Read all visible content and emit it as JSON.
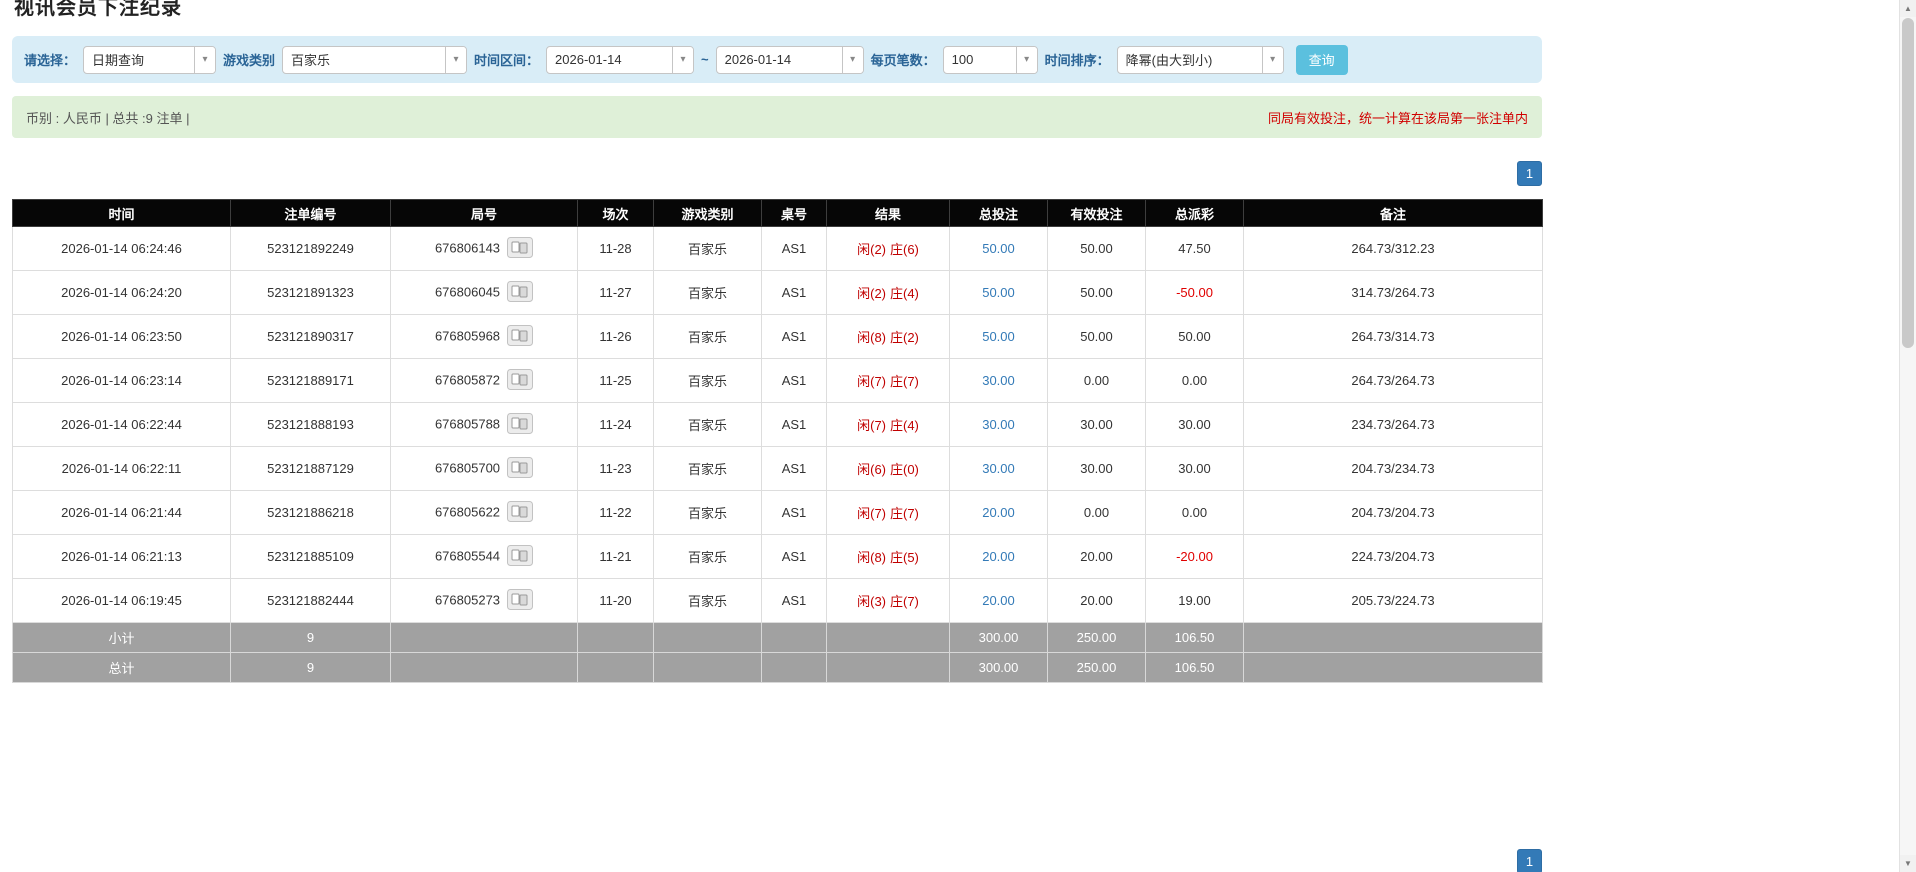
{
  "colors": {
    "accent_blue": "#337ab7",
    "filter_bar_bg": "#d9edf7",
    "summary_bar_bg": "#dff0d8",
    "table_header_bg": "#060606",
    "table_footer_bg": "#a1a1a1",
    "search_button_bg": "#5bc0de",
    "negative_red": "#e00000",
    "notice_red": "#d10000",
    "result_red": "#c00000"
  },
  "icons": {
    "chevron_down": "▾",
    "scroll_up": "▲",
    "scroll_down": "▼"
  },
  "page": {
    "title": "视讯会员下注纪录"
  },
  "filters": {
    "select_label": "请选择：",
    "select_value": "日期查询",
    "game_type_label": "游戏类别",
    "game_type_value": "百家乐",
    "time_range_label": "时间区间：",
    "date_from": "2026-01-14",
    "range_separator": "~",
    "date_to": "2026-01-14",
    "per_page_label": "每页笔数：",
    "per_page_value": "100",
    "sort_label": "时间排序：",
    "sort_value": "降幂(由大到小)",
    "search_button": "查询"
  },
  "summary": {
    "left": "币别 : 人民币 | 总共 :9 注单 |",
    "right": "同局有效投注，统一计算在该局第一张注单内"
  },
  "pagination": {
    "page": "1"
  },
  "table": {
    "headers": [
      "时间",
      "注单编号",
      "局号",
      "场次",
      "游戏类别",
      "桌号",
      "结果",
      "总投注",
      "有效投注",
      "总派彩",
      "备注"
    ],
    "rows": [
      {
        "time": "2026-01-14 06:24:46",
        "bet_id": "523121892249",
        "round": "676806143",
        "session": "11-28",
        "game": "百家乐",
        "table_no": "AS1",
        "result_player": "闲(2)",
        "result_banker": "庄(6)",
        "total_bet": "50.00",
        "valid_bet": "50.00",
        "payout": "47.50",
        "remark": "264.73/312.23"
      },
      {
        "time": "2026-01-14 06:24:20",
        "bet_id": "523121891323",
        "round": "676806045",
        "session": "11-27",
        "game": "百家乐",
        "table_no": "AS1",
        "result_player": "闲(2)",
        "result_banker": "庄(4)",
        "total_bet": "50.00",
        "valid_bet": "50.00",
        "payout": "-50.00",
        "remark": "314.73/264.73"
      },
      {
        "time": "2026-01-14 06:23:50",
        "bet_id": "523121890317",
        "round": "676805968",
        "session": "11-26",
        "game": "百家乐",
        "table_no": "AS1",
        "result_player": "闲(8)",
        "result_banker": "庄(2)",
        "total_bet": "50.00",
        "valid_bet": "50.00",
        "payout": "50.00",
        "remark": "264.73/314.73"
      },
      {
        "time": "2026-01-14 06:23:14",
        "bet_id": "523121889171",
        "round": "676805872",
        "session": "11-25",
        "game": "百家乐",
        "table_no": "AS1",
        "result_player": "闲(7)",
        "result_banker": "庄(7)",
        "total_bet": "30.00",
        "valid_bet": "0.00",
        "payout": "0.00",
        "remark": "264.73/264.73"
      },
      {
        "time": "2026-01-14 06:22:44",
        "bet_id": "523121888193",
        "round": "676805788",
        "session": "11-24",
        "game": "百家乐",
        "table_no": "AS1",
        "result_player": "闲(7)",
        "result_banker": "庄(4)",
        "total_bet": "30.00",
        "valid_bet": "30.00",
        "payout": "30.00",
        "remark": "234.73/264.73"
      },
      {
        "time": "2026-01-14 06:22:11",
        "bet_id": "523121887129",
        "round": "676805700",
        "session": "11-23",
        "game": "百家乐",
        "table_no": "AS1",
        "result_player": "闲(6)",
        "result_banker": "庄(0)",
        "total_bet": "30.00",
        "valid_bet": "30.00",
        "payout": "30.00",
        "remark": "204.73/234.73"
      },
      {
        "time": "2026-01-14 06:21:44",
        "bet_id": "523121886218",
        "round": "676805622",
        "session": "11-22",
        "game": "百家乐",
        "table_no": "AS1",
        "result_player": "闲(7)",
        "result_banker": "庄(7)",
        "total_bet": "20.00",
        "valid_bet": "0.00",
        "payout": "0.00",
        "remark": "204.73/204.73"
      },
      {
        "time": "2026-01-14 06:21:13",
        "bet_id": "523121885109",
        "round": "676805544",
        "session": "11-21",
        "game": "百家乐",
        "table_no": "AS1",
        "result_player": "闲(8)",
        "result_banker": "庄(5)",
        "total_bet": "20.00",
        "valid_bet": "20.00",
        "payout": "-20.00",
        "remark": "224.73/204.73"
      },
      {
        "time": "2026-01-14 06:19:45",
        "bet_id": "523121882444",
        "round": "676805273",
        "session": "11-20",
        "game": "百家乐",
        "table_no": "AS1",
        "result_player": "闲(3)",
        "result_banker": "庄(7)",
        "total_bet": "20.00",
        "valid_bet": "20.00",
        "payout": "19.00",
        "remark": "205.73/224.73"
      }
    ],
    "subtotal": {
      "label": "小计",
      "count": "9",
      "total_bet": "300.00",
      "valid_bet": "250.00",
      "payout": "106.50"
    },
    "total": {
      "label": "总计",
      "count": "9",
      "total_bet": "300.00",
      "valid_bet": "250.00",
      "payout": "106.50"
    }
  }
}
